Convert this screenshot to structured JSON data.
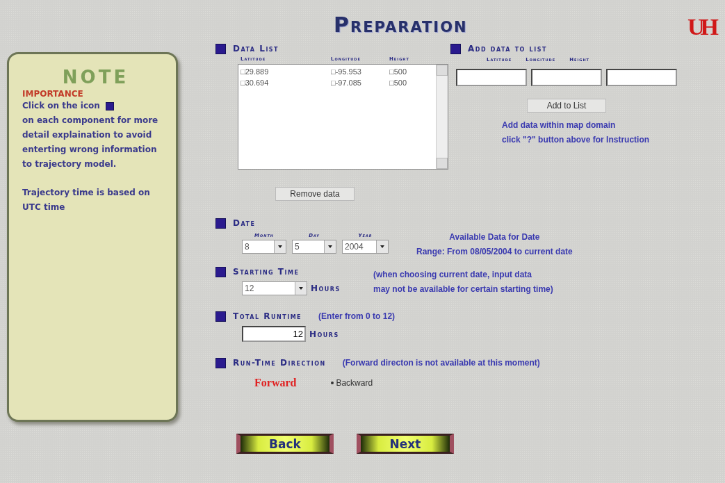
{
  "title": "Preparation",
  "logo": {
    "text": "UH"
  },
  "note": {
    "heading": "NOTE",
    "importance": "IMPORTANCE",
    "lines": [
      "Click on the icon",
      "on each component for more detail explaination to avoid enterting wrong information to trajectory model."
    ],
    "footer": "Trajectory time is based on UTC time"
  },
  "data_list": {
    "heading": "Data List",
    "columns": [
      "Latitude",
      "Longitude",
      "Height"
    ],
    "rows": [
      {
        "cells": [
          "□29.889",
          "□-95.953",
          "□500"
        ]
      },
      {
        "cells": [
          "□30.694",
          "□-97.085",
          "□500"
        ]
      }
    ],
    "button": "Remove data"
  },
  "add_data": {
    "heading": "Add data to list",
    "columns": [
      "Latitude",
      "Longitude",
      "Height"
    ],
    "button": "Add to List",
    "help": [
      "Add data within map domain",
      "click \"?\" button above for Instruction"
    ]
  },
  "date": {
    "heading": "Date",
    "fields": [
      {
        "label": "Month",
        "value": "8"
      },
      {
        "label": "Day",
        "value": "5"
      },
      {
        "label": "Year",
        "value": "2004"
      }
    ],
    "info": [
      "Available Data for Date",
      "Range:  From 08/05/2004 to current date"
    ]
  },
  "starting_time": {
    "heading": "Starting Time",
    "value": "12",
    "unit": "Hours",
    "note": [
      "(when choosing current date, input data",
      "may not be available for certain starting time)"
    ]
  },
  "total_runtime": {
    "heading": "Total Runtime",
    "hint": "(Enter from 0 to 12)",
    "value": "12",
    "unit": "Hours"
  },
  "direction": {
    "heading": "Run-Time Direction",
    "note": "(Forward directon is not available at this moment)",
    "options": [
      {
        "label": "Forward",
        "kind": "unavailable",
        "selected": false
      },
      {
        "label": "Backward",
        "kind": "radio",
        "selected": true
      }
    ]
  },
  "buttons": [
    "Back",
    "Next"
  ]
}
